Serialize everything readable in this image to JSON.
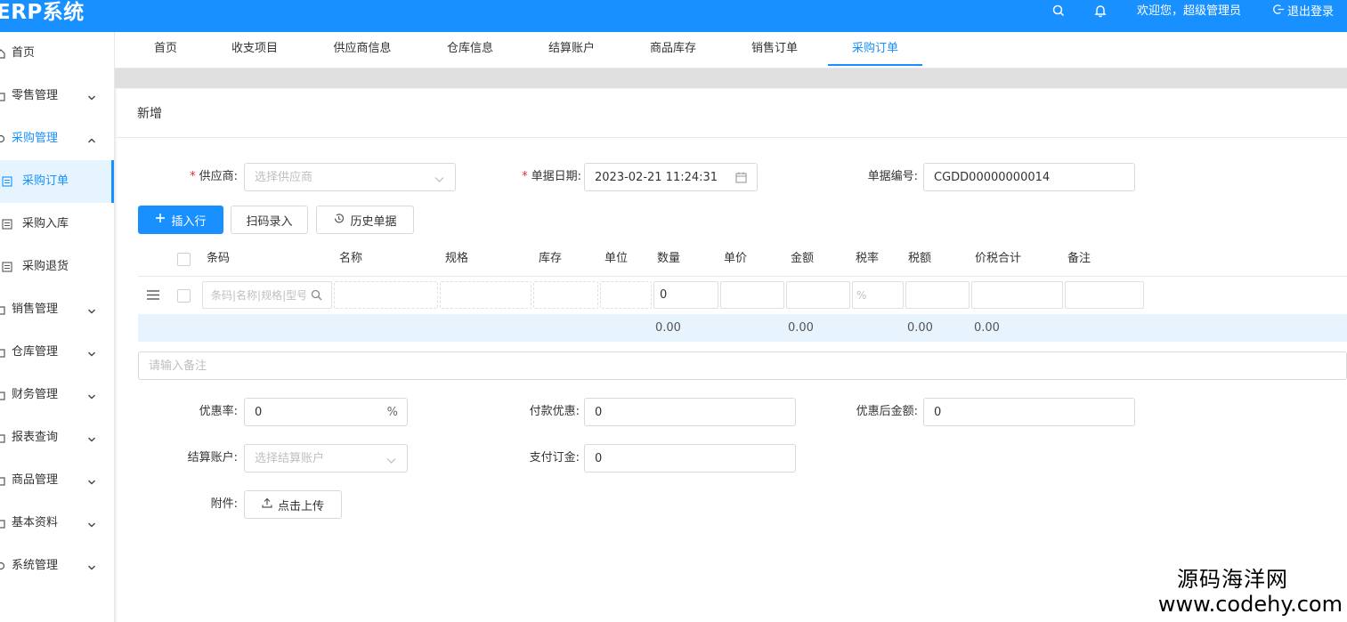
{
  "app": {
    "brand": "ERP系统",
    "welcome": "欢迎您，超级管理员",
    "logout": "退出登录"
  },
  "sidebar": {
    "items": [
      {
        "label": "首页"
      },
      {
        "label": "零售管理"
      },
      {
        "label": "采购管理"
      },
      {
        "label": "销售管理"
      },
      {
        "label": "仓库管理"
      },
      {
        "label": "财务管理"
      },
      {
        "label": "报表查询"
      },
      {
        "label": "商品管理"
      },
      {
        "label": "基本资料"
      },
      {
        "label": "系统管理"
      }
    ],
    "sub_items": [
      {
        "label": "采购订单"
      },
      {
        "label": "采购入库"
      },
      {
        "label": "采购退货"
      }
    ]
  },
  "tabs": [
    "首页",
    "收支项目",
    "供应商信息",
    "仓库信息",
    "结算账户",
    "商品库存",
    "销售订单",
    "采购订单"
  ],
  "active_tab": "采购订单",
  "form": {
    "title": "新增",
    "supplier_label": "供应商:",
    "supplier_placeholder": "选择供应商",
    "date_label": "单据日期:",
    "date_value": "2023-02-21 11:24:31",
    "number_label": "单据编号:",
    "number_value": "CGDD00000000014",
    "required_mark": "*"
  },
  "toolbar": {
    "insert_row": "插入行",
    "scan": "扫码录入",
    "history": "历史单据"
  },
  "table": {
    "columns": [
      "条码",
      "名称",
      "规格",
      "库存",
      "单位",
      "数量",
      "单价",
      "金额",
      "税率",
      "税额",
      "价税合计",
      "备注"
    ],
    "row": {
      "barcode_placeholder": "条码|名称|规格|型号",
      "quantity": "0",
      "tax_rate_suffix": "%"
    },
    "totals": {
      "quantity": "0.00",
      "amount": "0.00",
      "tax": "0.00",
      "total": "0.00"
    }
  },
  "remark_placeholder": "请输入备注",
  "footer": {
    "discount_rate_label": "优惠率:",
    "discount_rate_value": "0",
    "discount_rate_suffix": "%",
    "payment_discount_label": "付款优惠:",
    "payment_discount_value": "0",
    "after_discount_label": "优惠后金额:",
    "after_discount_value": "0",
    "account_label": "结算账户:",
    "account_placeholder": "选择结算账户",
    "deposit_label": "支付订金:",
    "deposit_value": "0",
    "attachment_label": "附件:",
    "upload_label": "点击上传"
  },
  "watermark": {
    "line1": "源码海洋网",
    "line2": "www.codehy.com"
  },
  "colors": {
    "primary": "#1890ff",
    "required": "#f5222d"
  }
}
